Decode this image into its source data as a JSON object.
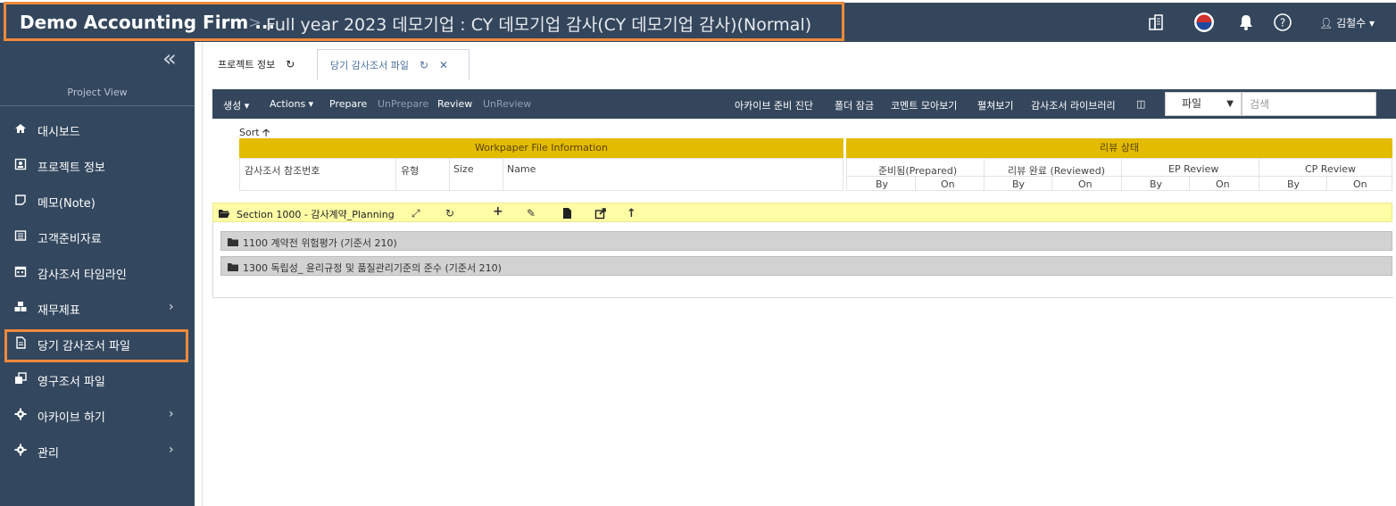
{
  "header": {
    "firm": "Demo Accounting Firm ...",
    "separator": ">",
    "project": "Full year 2023 데모기업 : CY 데모기업 감사(CY 데모기업 감사)(Normal)",
    "user": "김철수"
  },
  "sidebar": {
    "section_title": "Project View",
    "items": [
      {
        "label": "대시보드",
        "icon": "home-icon"
      },
      {
        "label": "프로젝트 정보",
        "icon": "id-card-icon"
      },
      {
        "label": "메모(Note)",
        "icon": "note-icon"
      },
      {
        "label": "고객준비자료",
        "icon": "list-icon"
      },
      {
        "label": "감사조서 타임라인",
        "icon": "calendar-icon"
      },
      {
        "label": "재무제표",
        "icon": "cubes-icon",
        "submenu": true
      },
      {
        "label": "당기 감사조서 파일",
        "icon": "file-icon",
        "active": true
      },
      {
        "label": "영구조서 파일",
        "icon": "clone-icon"
      },
      {
        "label": "아카이브 하기",
        "icon": "gear-icon",
        "submenu": true
      },
      {
        "label": "관리",
        "icon": "gear-icon",
        "submenu": true
      }
    ]
  },
  "tabs": [
    {
      "label": "프로젝트 정보"
    },
    {
      "label": "당기 감사조서 파일"
    }
  ],
  "toolbar": {
    "create": "생성",
    "actions": "Actions",
    "prepare": "Prepare",
    "unprepare": "UnPrepare",
    "review": "Review",
    "unreview": "UnReview",
    "archive_diag": "아카이브 준비 진단",
    "folder_lock": "폴더 잠금",
    "comments": "코멘트 모아보기",
    "expand": "펼쳐보기",
    "library": "감사조서 라이브러리",
    "select_value": "파일",
    "search_placeholder": "검색"
  },
  "table": {
    "sort": "Sort",
    "group1": "Workpaper File Information",
    "group2": "리뷰 상태",
    "cols": [
      "감사조서 참조번호",
      "유형",
      "Size",
      "Name"
    ],
    "review_cols": [
      "준비됨(Prepared)",
      "리뷰 완료 (Reviewed)",
      "EP Review",
      "CP Review"
    ],
    "by": "By",
    "on": "On"
  },
  "tree": {
    "section": "Section 1000 - 감사계약_Planning",
    "folders": [
      "1100 계약전 위험평가 (기준서 210)",
      "1300 독립성_ 윤리규정 및 품질관리기준의 준수 (기준서 210)"
    ]
  },
  "colors": {
    "header_bg": "#34465c",
    "highlight": "#f08a3a",
    "group_header": "#e3bb00",
    "section_bg": "#fffca6"
  }
}
